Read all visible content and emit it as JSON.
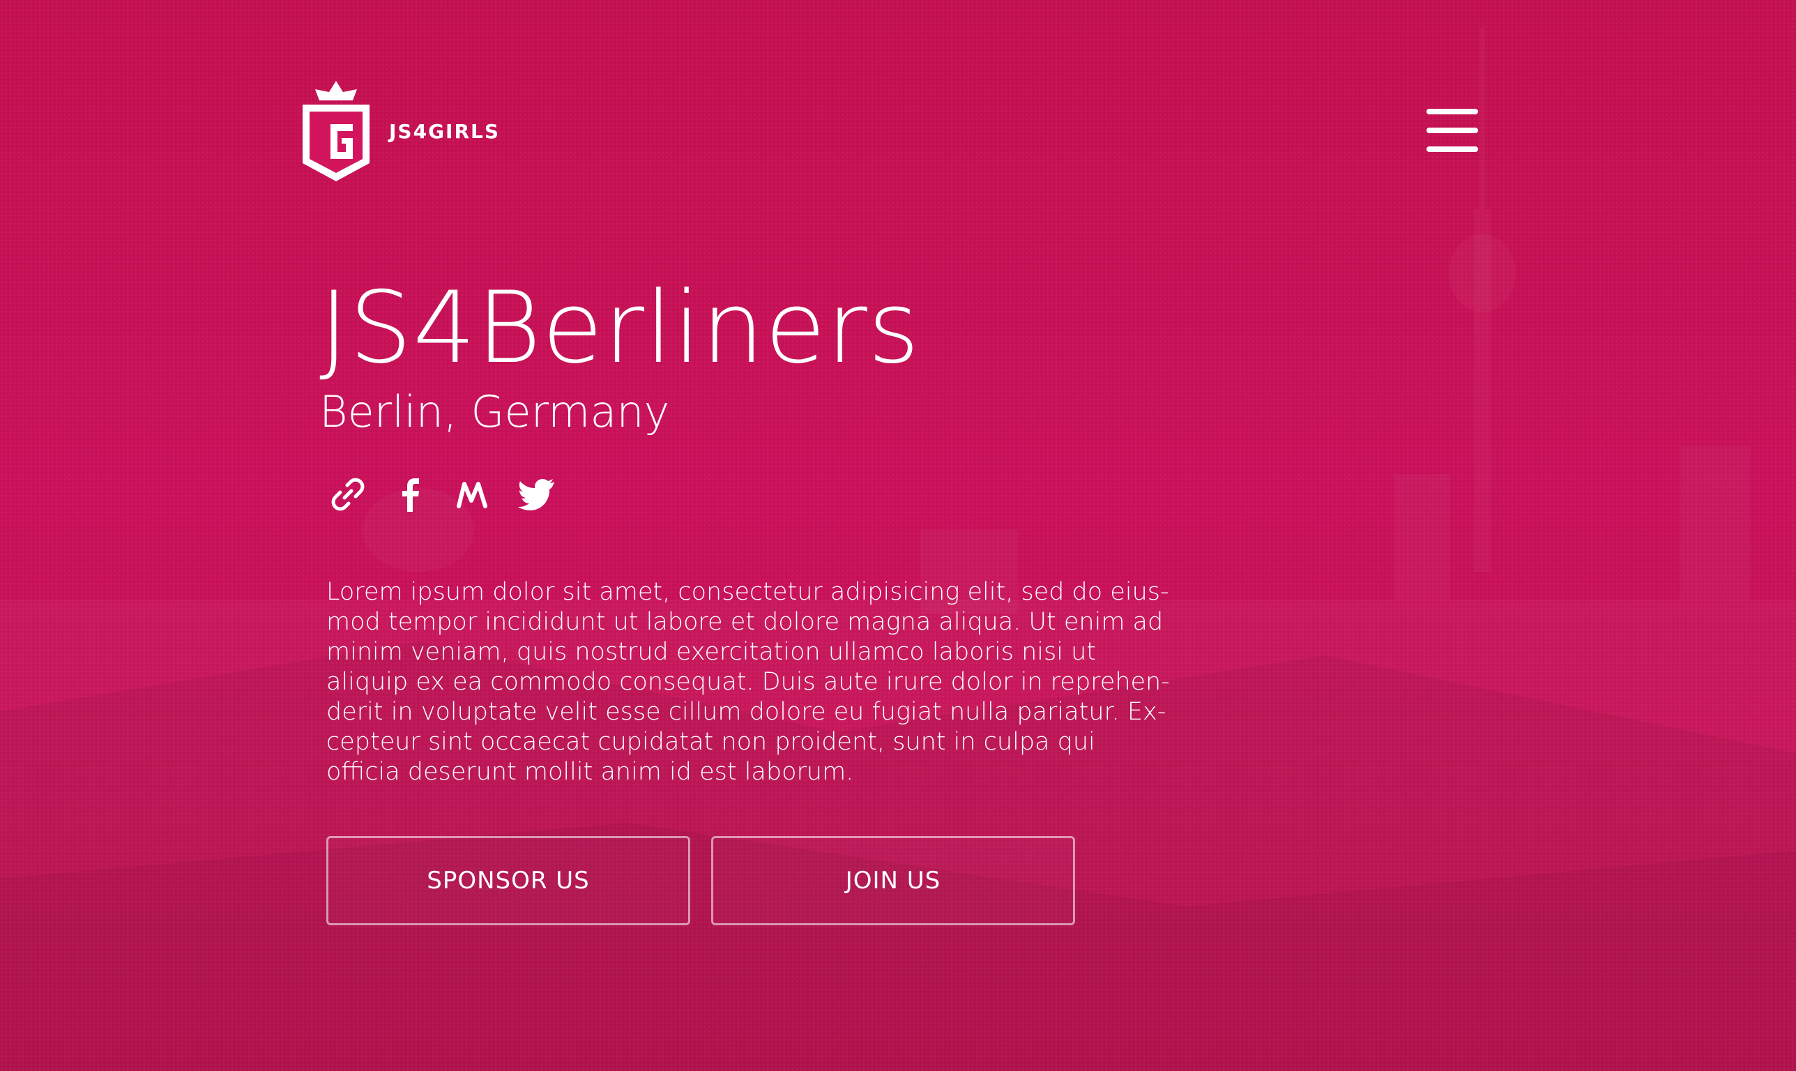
{
  "brand": {
    "name": "JS4GIRLS",
    "logo_icon": "crown-shield-g-icon"
  },
  "nav": {
    "menu_icon": "hamburger-menu-icon"
  },
  "hero": {
    "title": "JS4Berliners",
    "subtitle": "Berlin, Germany",
    "social": [
      {
        "name": "link-icon"
      },
      {
        "name": "facebook-icon"
      },
      {
        "name": "meetup-icon"
      },
      {
        "name": "twitter-icon"
      }
    ],
    "description": "Lorem ipsum dolor sit amet, consectetur adipisicing elit, sed do eius-mod tempor incididunt ut labore et dolore magna aliqua. Ut enim ad minim veniam, quis nostrud exercitation ullamco laboris nisi ut aliquip ex ea commodo consequat. Duis aute irure dolor in reprehen-derit in voluptate velit esse cillum dolore eu fugiat nulla pariatur. Ex-cepteur sint occaecat cupidatat non proident, sunt in culpa qui officia deserunt mollit anim id est laborum.",
    "buttons": {
      "sponsor": "SPONSOR US",
      "join": "JOIN US"
    }
  },
  "colors": {
    "background": "#c3104f",
    "accent": "#ffffff"
  }
}
